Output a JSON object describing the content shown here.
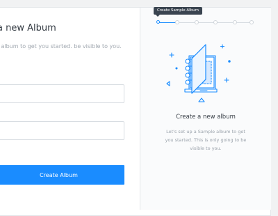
{
  "form": {
    "title": "a new Album",
    "subtitle": "e album to get you started. be visible to you.",
    "field_1_value": "",
    "field_2_value": "",
    "submit_label": "Create Album"
  },
  "stepper": {
    "tooltip": "Create Sample Album",
    "total_steps": 6,
    "current_step": 1
  },
  "panel": {
    "title": "Create a new album",
    "description": "Let's set up a Sample album to get you started. This is only going to be visible to you."
  },
  "colors": {
    "accent": "#1a8cff",
    "text_dark": "#343b43",
    "text_muted": "#9aa2ab"
  },
  "icons": {
    "illustration": "album-book-illustration"
  }
}
